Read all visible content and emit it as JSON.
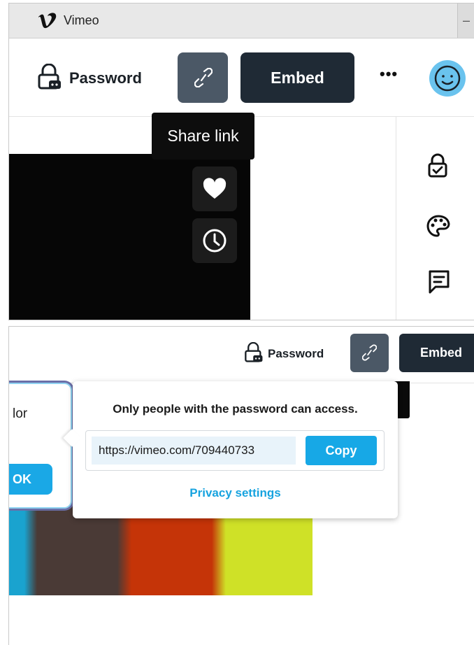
{
  "window": {
    "title": "Vimeo",
    "control": "–"
  },
  "header": {
    "password_label": "Password",
    "embed_label": "Embed",
    "more_label": "•••"
  },
  "tooltip": {
    "text": "Share link"
  },
  "video_actions": [
    "like",
    "watch-later"
  ],
  "right_rail": [
    "privacy-lock",
    "appearance-palette",
    "interaction-comment"
  ],
  "color_dialog": {
    "text_fragment": "lor",
    "ok_label": "OK"
  },
  "share_popover": {
    "heading": "Only people with the password can access.",
    "url": "https://vimeo.com/709440733",
    "copy_label": "Copy",
    "privacy_link": "Privacy settings"
  },
  "colors": {
    "embed_button": "#1f2a35",
    "link_button": "#4b5866",
    "accent_blue": "#17a8e6",
    "avatar": "#6ac3ee"
  }
}
